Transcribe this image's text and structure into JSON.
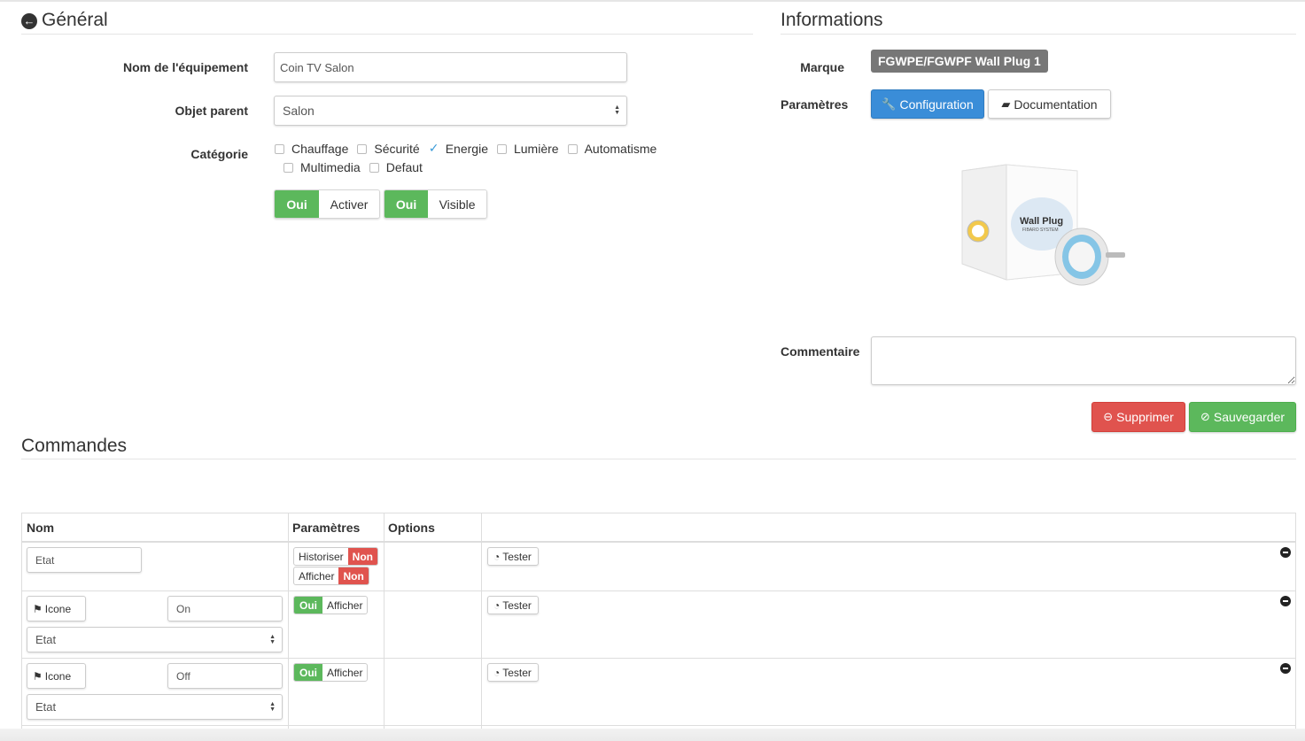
{
  "general": {
    "title": "Général"
  },
  "informations": {
    "title": "Informations"
  },
  "form": {
    "name_label": "Nom de l'équipement",
    "name_value": "Coin TV Salon",
    "parent_label": "Objet parent",
    "parent_value": "Salon",
    "category_label": "Catégorie",
    "categories": [
      {
        "label": "Chauffage",
        "checked": false
      },
      {
        "label": "Sécurité",
        "checked": false
      },
      {
        "label": "Energie",
        "checked": true
      },
      {
        "label": "Lumière",
        "checked": false
      },
      {
        "label": "Automatisme",
        "checked": false
      },
      {
        "label": "Multimedia",
        "checked": false
      },
      {
        "label": "Defaut",
        "checked": false
      }
    ],
    "toggle_yes": "Oui",
    "activate_label": "Activer",
    "visible_label": "Visible"
  },
  "info": {
    "brand_label": "Marque",
    "brand_value": "FGWPE/FGWPF Wall Plug 1",
    "params_label": "Paramètres",
    "config_button": "Configuration",
    "doc_button": "Documentation",
    "product_text_brand": "Wall Plug",
    "product_text_small": "FIBARO SYSTEM",
    "comment_label": "Commentaire"
  },
  "actions": {
    "delete": "Supprimer",
    "save": "Sauvegarder"
  },
  "commands": {
    "title": "Commandes",
    "headers": {
      "name": "Nom",
      "params": "Paramètres",
      "options": "Options"
    },
    "row1": {
      "name": "Etat",
      "historize": "Historiser",
      "display": "Afficher",
      "no": "Non",
      "test": "Tester"
    },
    "row2": {
      "icon": "Icone",
      "value": "On",
      "info": "Etat",
      "yes": "Oui",
      "display": "Afficher",
      "test": "Tester"
    },
    "row3": {
      "icon": "Icone",
      "value": "Off",
      "info": "Etat",
      "yes": "Oui",
      "display": "Afficher",
      "test": "Tester"
    }
  }
}
